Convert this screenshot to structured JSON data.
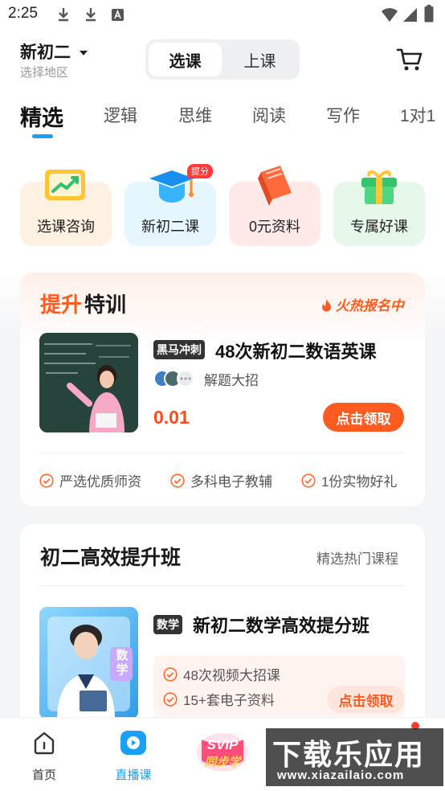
{
  "status_bar": {
    "time": "2:25"
  },
  "header": {
    "grade": "新初二",
    "region_hint": "选择地区",
    "segment": {
      "active": "选课",
      "inactive": "上课"
    }
  },
  "tabs": [
    "精选",
    "逻辑",
    "思维",
    "阅读",
    "写作",
    "1对1"
  ],
  "tiles": [
    {
      "label": "选课咨询",
      "bg": "#fff1e2"
    },
    {
      "label": "新初二课",
      "bg": "#e6f6ff",
      "badge": "提分"
    },
    {
      "label": "0元资料",
      "bg": "#ffe9e9"
    },
    {
      "label": "专属好课",
      "bg": "#e6f8ea"
    }
  ],
  "promo": {
    "title_highlight": "提升",
    "title_rest": "特训",
    "hot_label": "火热报名中",
    "course": {
      "tag": "黑马冲刺",
      "name": "48次新初二数语英课",
      "subtitle": "解题大招",
      "price": "0.01",
      "cta": "点击领取"
    },
    "features": [
      "严选优质师资",
      "多科电子教辅",
      "1份实物好礼"
    ]
  },
  "section2": {
    "title": "初二高效提升班",
    "more": "精选热门课程",
    "course": {
      "tag": "数学",
      "thumb_text": "数学",
      "name": "新初二数学高效提分班",
      "features": [
        "48次视频大招课",
        "15+套电子资料"
      ],
      "cta": "点击领取"
    }
  },
  "bottom_nav": {
    "home": "首页",
    "live": "直播课",
    "svip": "SVIP",
    "svip_sub": "同步学"
  },
  "watermark": {
    "main": "下载乐应用",
    "url": "www.xiazailaio.com"
  },
  "colors": {
    "accent": "#1aa0f5",
    "orange": "#ff5a1f"
  }
}
